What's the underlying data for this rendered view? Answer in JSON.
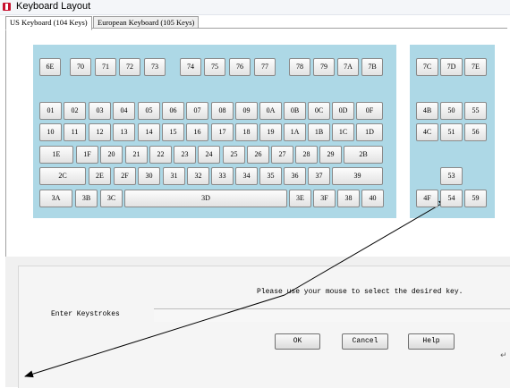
{
  "window": {
    "title": "Keyboard Layout"
  },
  "tabs": [
    {
      "label": "US Keyboard (104 Keys)",
      "active": true
    },
    {
      "label": "European Keyboard (105 Keys)",
      "active": false
    }
  ],
  "main_keys": [
    [
      "6E",
      "70",
      "71",
      "72",
      "73",
      "74",
      "75",
      "76",
      "77",
      "78",
      "79",
      "7A",
      "7B"
    ],
    [
      "01",
      "02",
      "03",
      "04",
      "05",
      "06",
      "07",
      "08",
      "09",
      "0A",
      "0B",
      "0C",
      "0D",
      "0F"
    ],
    [
      "10",
      "11",
      "12",
      "13",
      "14",
      "15",
      "16",
      "17",
      "18",
      "19",
      "1A",
      "1B",
      "1C",
      "1D"
    ],
    [
      "1E",
      "1F",
      "20",
      "21",
      "22",
      "23",
      "24",
      "25",
      "26",
      "27",
      "28",
      "29",
      "2B"
    ],
    [
      "2C",
      "2E",
      "2F",
      "30",
      "31",
      "32",
      "33",
      "34",
      "35",
      "36",
      "37",
      "39"
    ],
    [
      "3A",
      "3B",
      "3C",
      "3D",
      "3E",
      "3F",
      "38",
      "40"
    ]
  ],
  "side_keys": [
    [
      "7C",
      "7D",
      "7E"
    ],
    [
      "4B",
      "50",
      "55"
    ],
    [
      "4C",
      "51",
      "56"
    ],
    [
      "53"
    ],
    [
      "4F",
      "54",
      "59"
    ]
  ],
  "instructions": "Please use your mouse to select the desired key.",
  "keystrokes": {
    "label": "Enter Keystrokes",
    "value": "",
    "placeholder": ""
  },
  "buttons": {
    "ok": "OK",
    "cancel": "Cancel",
    "help": "Help"
  },
  "colors": {
    "keyboard_panel": "#add8e6",
    "app_icon": "#c8102e",
    "arrow": "#000000"
  }
}
